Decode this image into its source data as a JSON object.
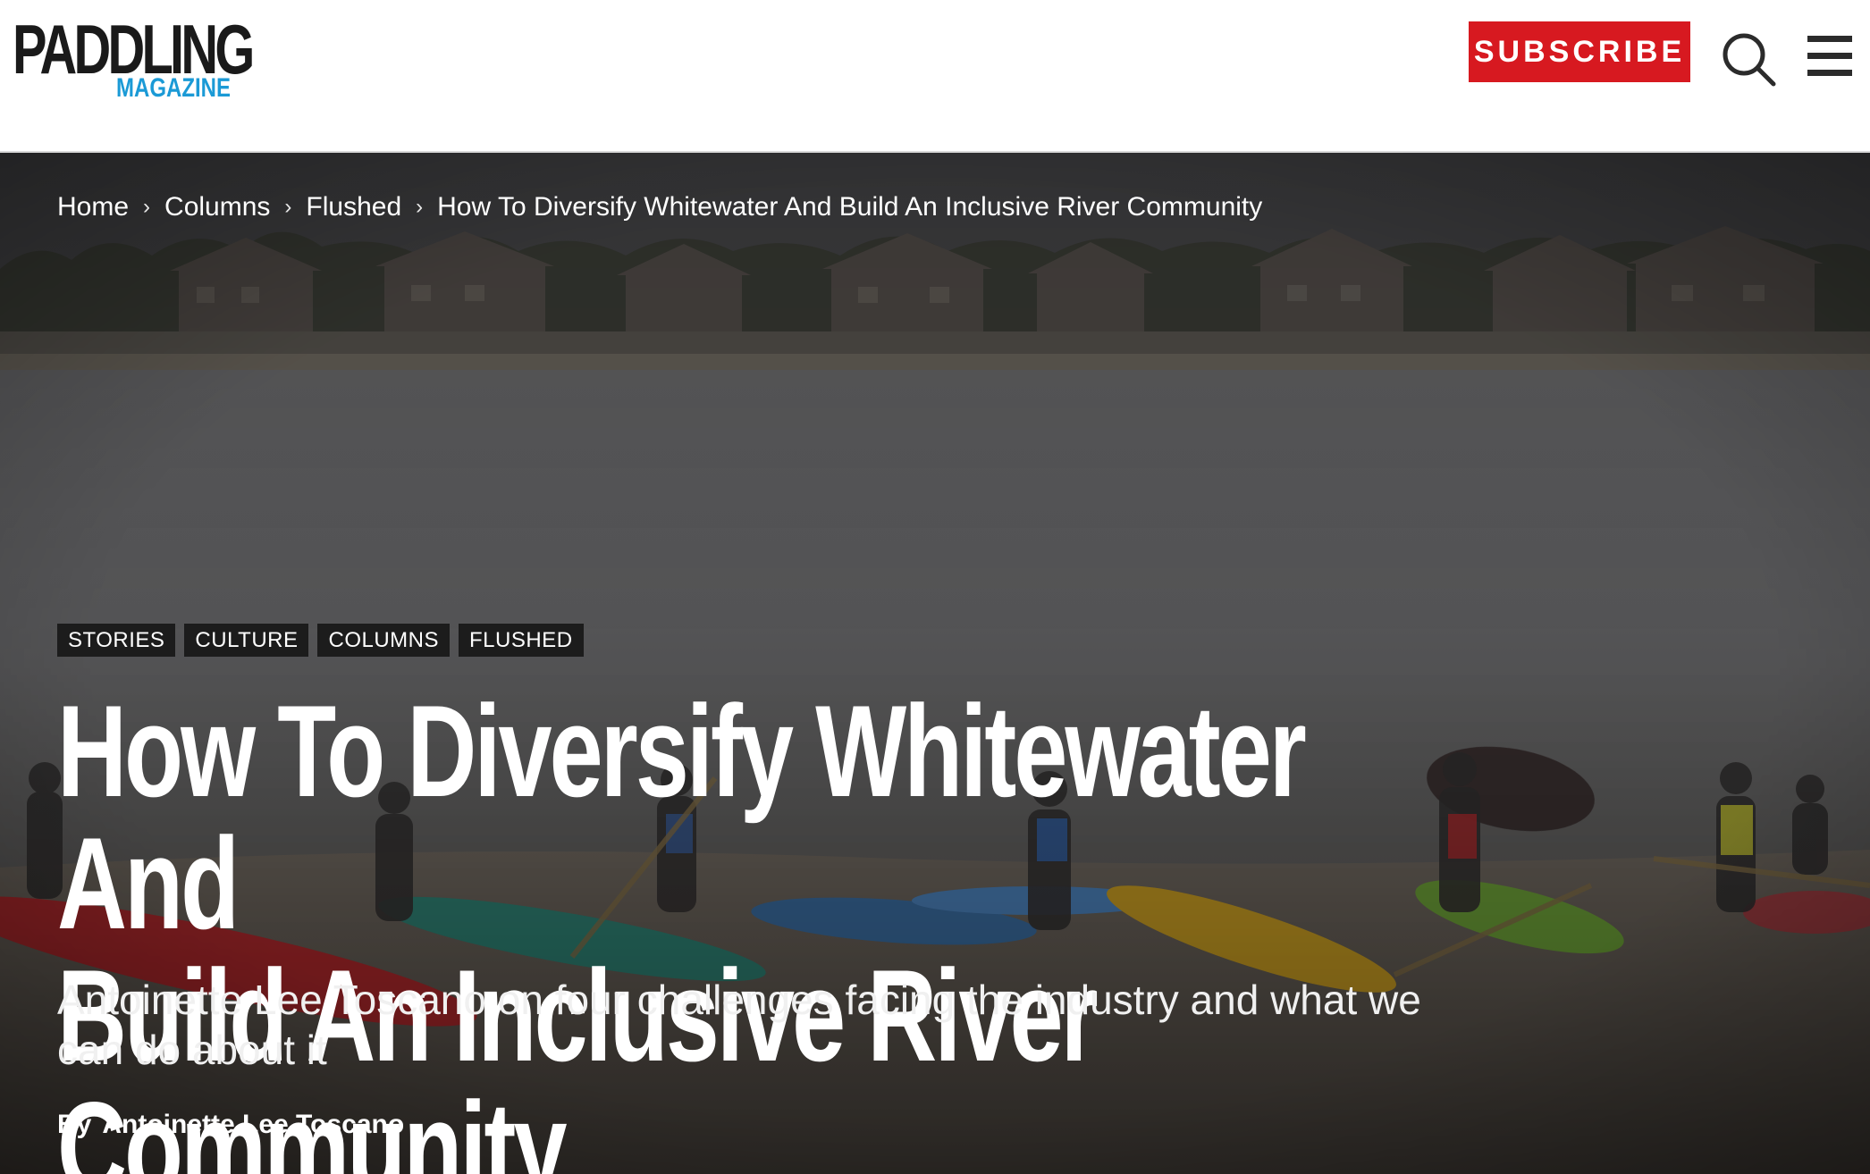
{
  "header": {
    "logo_main": "PADDLING",
    "logo_sub": "MAGAZINE",
    "subscribe_label": "SUBSCRIBE",
    "search_icon": "search-icon",
    "menu_icon": "hamburger-menu-icon",
    "colors": {
      "brand_red": "#d71920",
      "brand_blue": "#1b9ad6",
      "logo_dark": "#1a1a1a"
    }
  },
  "breadcrumb": {
    "items": [
      "Home",
      "Columns",
      "Flushed"
    ],
    "current": "How To Diversify Whitewater And Build An Inclusive River Community",
    "separator": "›"
  },
  "article": {
    "tags": [
      "STORIES",
      "CULTURE",
      "COLUMNS",
      "FLUSHED"
    ],
    "title_line1": "How To Diversify Whitewater And",
    "title_line2": "Build An Inclusive River Community",
    "subtitle": "Antoinette Lee Toscano on four challenges facing the industry and what we can do about it",
    "byline_prefix": "By",
    "author": "Antoinette Lee Toscano"
  }
}
